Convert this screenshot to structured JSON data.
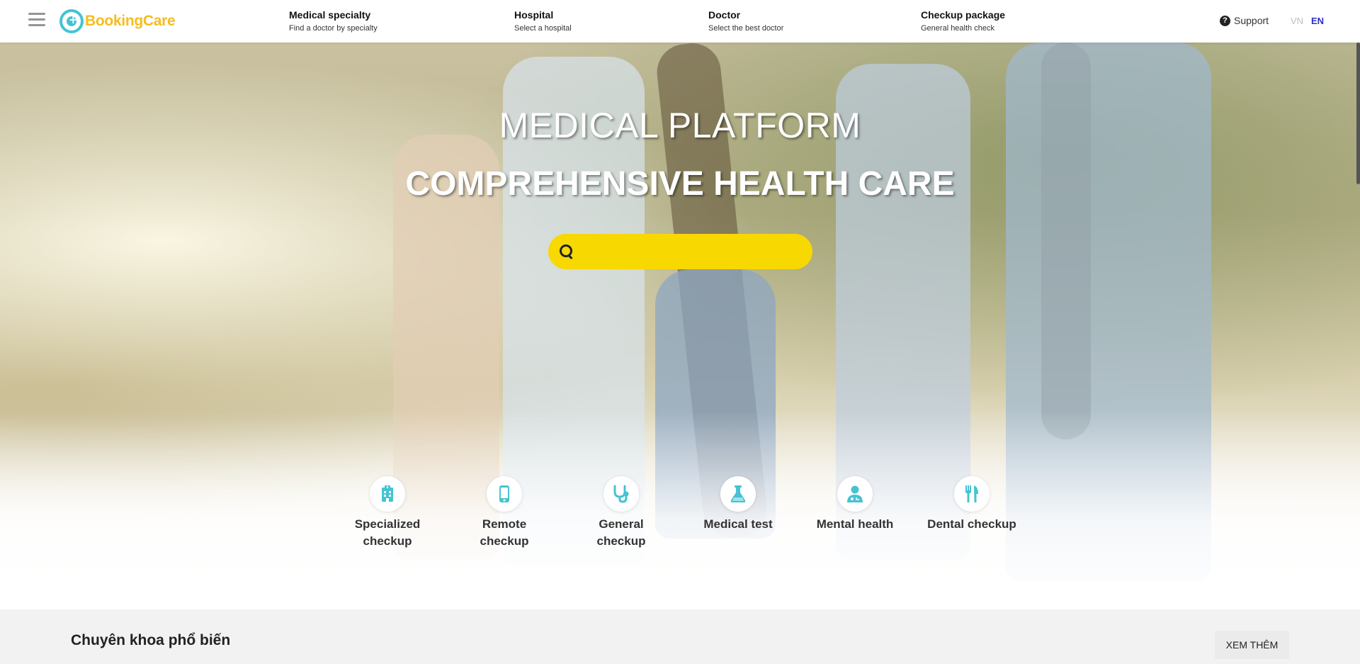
{
  "header": {
    "logo_text": "BookingCare",
    "nav": [
      {
        "title": "Medical specialty",
        "subtitle": "Find a doctor by specialty"
      },
      {
        "title": "Hospital",
        "subtitle": "Select a hospital"
      },
      {
        "title": "Doctor",
        "subtitle": "Select the best doctor"
      },
      {
        "title": "Checkup package",
        "subtitle": "General health check"
      }
    ],
    "support_label": "Support",
    "lang_vn": "VN",
    "lang_en": "EN"
  },
  "hero": {
    "title1": "MEDICAL PLATFORM",
    "title2": "COMPREHENSIVE HEALTH CARE",
    "search_placeholder": "",
    "options": [
      {
        "label": "Specialized checkup",
        "icon": "hospital-building-icon"
      },
      {
        "label": "Remote checkup",
        "icon": "phone-icon"
      },
      {
        "label": "General checkup",
        "icon": "stethoscope-icon"
      },
      {
        "label": "Medical test",
        "icon": "flask-icon"
      },
      {
        "label": "Mental health",
        "icon": "doctor-user-icon"
      },
      {
        "label": "Dental checkup",
        "icon": "utensils-icon"
      }
    ]
  },
  "section": {
    "title": "Chuyên khoa phổ biến",
    "more_button": "XEM THÊM"
  },
  "colors": {
    "accent_yellow": "#f7d800",
    "brand_blue": "#45c3d2",
    "brand_yellow": "#f5bd1f",
    "lang_active": "#2e2ec4",
    "icon_blue": "#45c3d2"
  }
}
